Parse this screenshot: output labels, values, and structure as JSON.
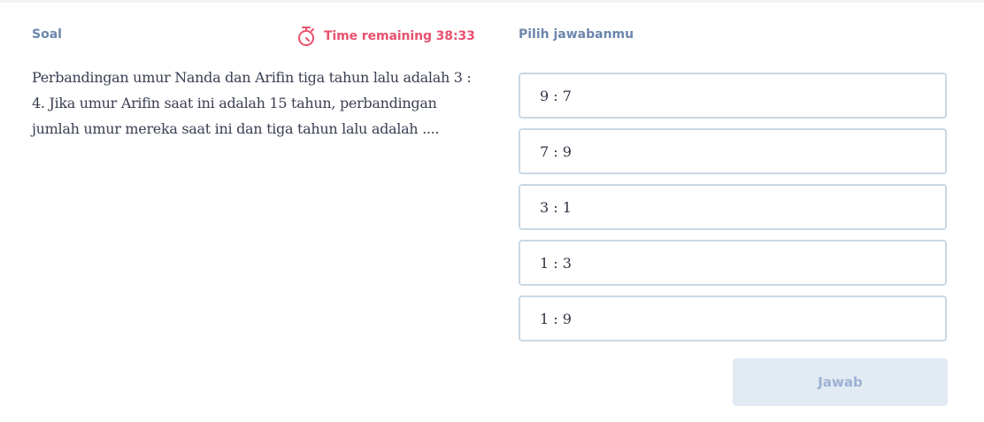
{
  "question_panel": {
    "label": "Soal",
    "timer_text": "Time remaining 38:33",
    "timer_icon": "stopwatch-icon",
    "question_text": "Perbandingan umur Nanda dan Arifin tiga tahun lalu adalah 3 : 4. Jika umur Arifin saat ini adalah 15 tahun, perbandingan jumlah umur mereka saat ini dan tiga tahun lalu adalah ...."
  },
  "answer_panel": {
    "title": "Pilih jawabanmu",
    "options": [
      {
        "label": "9 : 7"
      },
      {
        "label": "7 : 9"
      },
      {
        "label": "3 : 1"
      },
      {
        "label": "1 : 3"
      },
      {
        "label": "1 : 9"
      }
    ],
    "submit_label": "Jawab"
  },
  "colors": {
    "label": "#6d86ad",
    "timer": "#e8516e",
    "option_border": "#c8d8e6",
    "submit_bg": "#e2eaf4",
    "submit_text": "#9bb2d1"
  }
}
